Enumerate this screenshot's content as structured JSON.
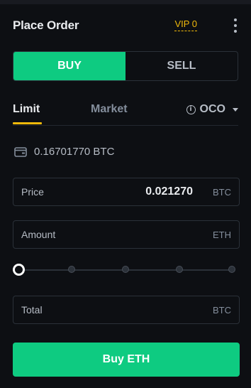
{
  "header": {
    "title": "Place Order",
    "vip_label": "VIP 0",
    "menu_icon": "kebab-menu-icon"
  },
  "side_toggle": {
    "buy_label": "BUY",
    "sell_label": "SELL",
    "selected": "BUY"
  },
  "order_types": {
    "tabs": [
      "Limit",
      "Market",
      "OCO"
    ],
    "selected": "Limit"
  },
  "balance": {
    "amount": "0.16701770 BTC",
    "icon": "wallet-icon"
  },
  "form": {
    "price_label": "Price",
    "price_value": "0.021270",
    "price_unit": "BTC",
    "amount_label": "Amount",
    "amount_value": "",
    "amount_unit": "ETH",
    "total_label": "Total",
    "total_unit": "BTC"
  },
  "slider": {
    "percent": 0,
    "steps": [
      0,
      25,
      50,
      75,
      100
    ]
  },
  "submit": {
    "label": "Buy ETH"
  },
  "colors": {
    "buy": "#0ecb81",
    "accent": "#f0b90b",
    "background": "#0d0f13",
    "border": "#2b3139"
  }
}
